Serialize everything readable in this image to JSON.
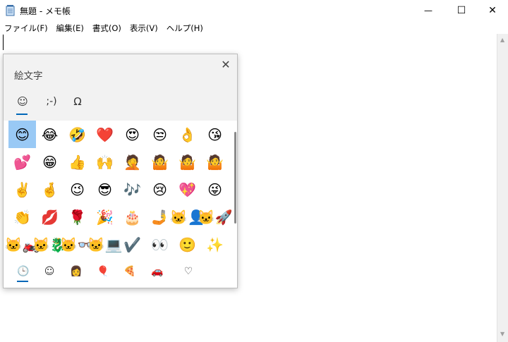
{
  "window": {
    "title": "無題 - メモ帳",
    "icons": {
      "app": "notepad-icon",
      "minimize": "minimize-icon",
      "maximize": "maximize-icon",
      "close": "close-icon"
    },
    "controls": {
      "minimize": "—",
      "maximize": "☐",
      "close": "✕"
    }
  },
  "menu": {
    "items": [
      {
        "label": "ファイル(F)"
      },
      {
        "label": "編集(E)"
      },
      {
        "label": "書式(O)"
      },
      {
        "label": "表示(V)"
      },
      {
        "label": "ヘルプ(H)"
      }
    ]
  },
  "emoji_panel": {
    "title": "絵文字",
    "close": "✕",
    "tabs": [
      {
        "label": "☺",
        "icon": "smiley-tab-icon"
      },
      {
        "label": ";-)",
        "icon": "kaomoji-tab-icon"
      },
      {
        "label": "Ω",
        "icon": "symbols-tab-icon"
      }
    ],
    "selected_index": 0,
    "emojis": [
      "😊",
      "😂",
      "🤣",
      "❤️",
      "😍",
      "😒",
      "👌",
      "😘",
      "💕",
      "😁",
      "👍",
      "🙌",
      "🤦",
      "🤷",
      "🤷",
      "🤷",
      "✌️",
      "🤞",
      "😉",
      "😎",
      "🎶",
      "😢",
      "💖",
      "😜",
      "👏",
      "💋",
      "🌹",
      "🎉",
      "🎂",
      "🤳",
      "🐱‍👤",
      "🐱‍🚀",
      "🐱‍🏍",
      "🐱‍🐉",
      "🐱‍👓",
      "🐱‍💻",
      "✔️",
      "👀",
      "🙂",
      "✨"
    ],
    "bottom_categories": [
      {
        "label": "🕒",
        "icon": "recent-clock-icon"
      },
      {
        "label": "☺",
        "icon": "people-face-icon"
      },
      {
        "label": "👩",
        "icon": "person-icon"
      },
      {
        "label": "🎈",
        "icon": "celebration-icon"
      },
      {
        "label": "🍕",
        "icon": "food-icon"
      },
      {
        "label": "🚗",
        "icon": "travel-car-icon"
      },
      {
        "label": "♡",
        "icon": "heart-symbols-icon"
      }
    ]
  },
  "colors": {
    "accent": "#0067b8",
    "selected_cell": "#99c9f5",
    "panel_header": "#f2f2f2"
  }
}
